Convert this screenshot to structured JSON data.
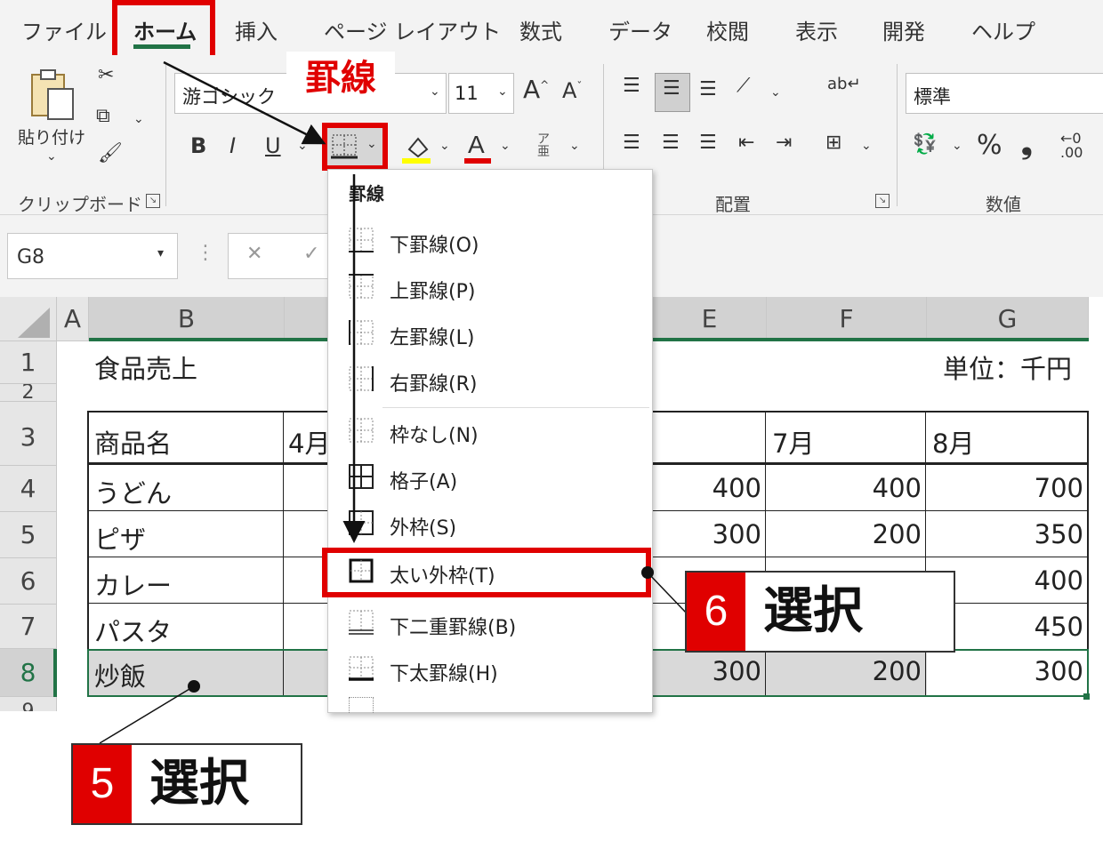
{
  "menu": {
    "tabs": [
      "ファイル",
      "ホーム",
      "挿入",
      "ページ レイアウト",
      "数式",
      "データ",
      "校閲",
      "表示",
      "開発",
      "ヘルプ"
    ],
    "active": "ホーム"
  },
  "ribbon": {
    "clipboard": {
      "paste_label": "貼り付け",
      "group_label": "クリップボード"
    },
    "font": {
      "font_name": "游ゴシック",
      "font_size": "11",
      "bold": "B",
      "italic": "I",
      "underline": "U",
      "phonetic": "ア亜"
    },
    "alignment": {
      "group_label": "配置"
    },
    "number": {
      "format": "標準",
      "percent": "%",
      "comma": "❟",
      "group_label": "数値"
    },
    "border_callout": "罫線"
  },
  "formula_bar": {
    "name_box": "G8"
  },
  "grid": {
    "columns": [
      "A",
      "B",
      "E",
      "F",
      "G"
    ],
    "rows": [
      "1",
      "2",
      "3",
      "4",
      "5",
      "6",
      "7",
      "8",
      "9"
    ],
    "title": "食品売上",
    "unit": "単位：千円",
    "headers": {
      "b": "商品名",
      "c": "4月",
      "f": "7月",
      "g": "8月"
    },
    "items": [
      "うどん",
      "ピザ",
      "カレー",
      "パスタ",
      "炒飯"
    ],
    "values_e": [
      "400",
      "300",
      "",
      "",
      "300"
    ],
    "values_f": [
      "400",
      "200",
      "",
      "",
      "200"
    ],
    "values_g": [
      "700",
      "350",
      "400",
      "450",
      "300"
    ]
  },
  "border_menu": {
    "title": "罫線",
    "items": [
      "下罫線(O)",
      "上罫線(P)",
      "左罫線(L)",
      "右罫線(R)",
      "枠なし(N)",
      "格子(A)",
      "外枠(S)",
      "太い外枠(T)",
      "下二重罫線(B)",
      "下太罫線(H)"
    ],
    "selected": "太い外枠(T)"
  },
  "annotations": [
    {
      "number": "5",
      "text": "選択"
    },
    {
      "number": "6",
      "text": "選択"
    }
  ],
  "colors": {
    "accent_red": "#e00000",
    "excel_green": "#217346"
  }
}
